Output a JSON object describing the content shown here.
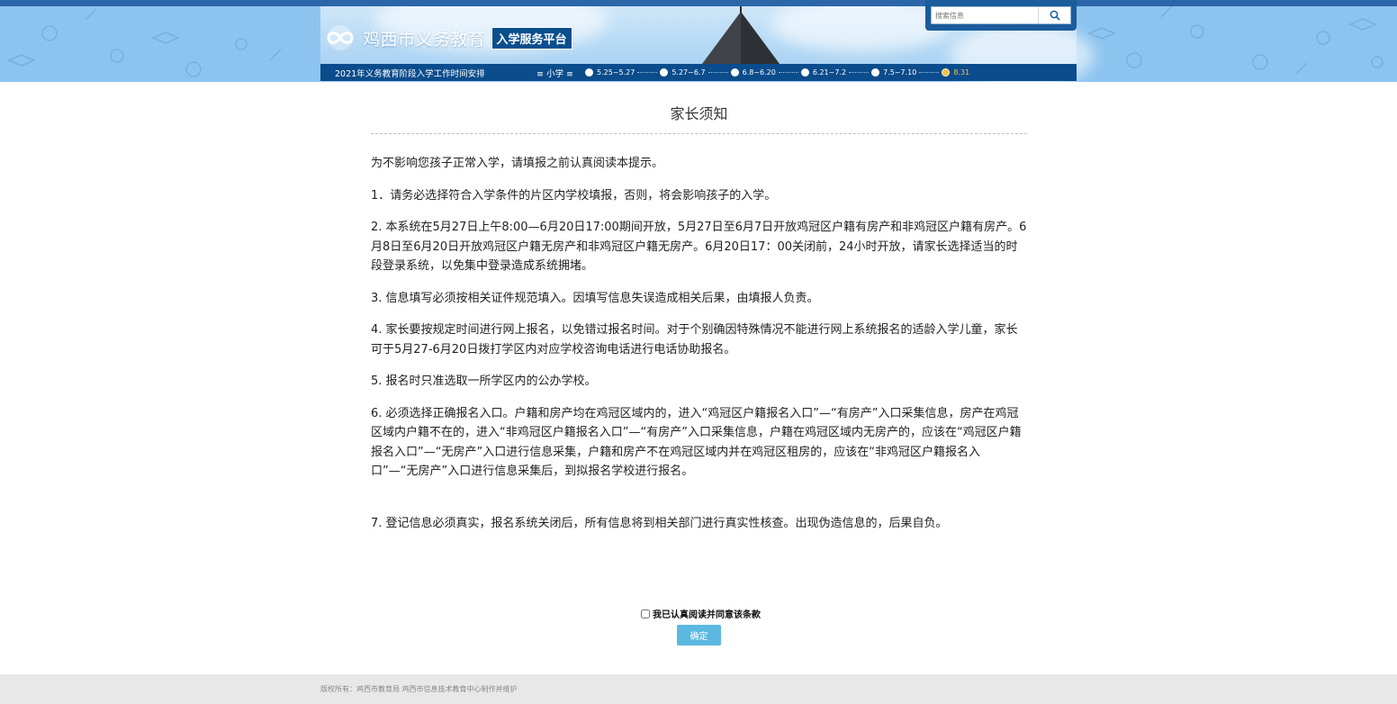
{
  "header": {
    "site_name": "鸡西市义务教育",
    "platform_badge": "入学服务平台",
    "logo_icon": "infinity-logo-icon"
  },
  "search": {
    "placeholder": "搜索信息",
    "icon": "search-icon"
  },
  "timeline": {
    "title": "2021年义务教育阶段入学工作时间安排",
    "school_level": "≡ 小学 ≡",
    "steps": [
      {
        "label": "5.25~5.27"
      },
      {
        "label": "5.27~6.7"
      },
      {
        "label": "6.8~6.20"
      },
      {
        "label": "6.21~7.2"
      },
      {
        "label": "7.5~7.10"
      },
      {
        "label": "8.31"
      }
    ]
  },
  "notice": {
    "title": "家长须知",
    "intro": "为不影响您孩子正常入学，请填报之前认真阅读本提示。",
    "items": [
      "1．请务必选择符合入学条件的片区内学校填报，否则，将会影响孩子的入学。",
      "2. 本系统在5月27日上午8:00—6月20日17:00期间开放，5月27日至6月7日开放鸡冠区户籍有房产和非鸡冠区户籍有房产。6月8日至6月20日开放鸡冠区户籍无房产和非鸡冠区户籍无房产。6月20日17：00关闭前，24小时开放，请家长选择适当的时段登录系统，以免集中登录造成系统拥堵。",
      "3. 信息填写必须按相关证件规范填入。因填写信息失误造成相关后果，由填报人负责。",
      "4. 家长要按规定时间进行网上报名，以免错过报名时间。对于个别确因特殊情况不能进行网上系统报名的适龄入学儿童，家长可于5月27-6月20日拨打学区内对应学校咨询电话进行电话协助报名。",
      "5. 报名时只准选取一所学区内的公办学校。",
      "6. 必须选择正确报名入口。户籍和房产均在鸡冠区域内的，进入“鸡冠区户籍报名入口”—“有房产”入口采集信息，房产在鸡冠区域内户籍不在的，进入“非鸡冠区户籍报名入口”—“有房产”入口采集信息，户籍在鸡冠区域内无房产的，应该在“鸡冠区户籍报名入口”—“无房产”入口进行信息采集，户籍和房产不在鸡冠区域内并在鸡冠区租房的，应该在“非鸡冠区户籍报名入口”—“无房产”入口进行信息采集后，到拟报名学校进行报名。",
      "7.  登记信息必须真实，报名系统关闭后，所有信息将到相关部门进行真实性核查。出现伪造信息的，后果自负。"
    ]
  },
  "agreement": {
    "label": "我已认真阅读并同意该条款",
    "checked": false
  },
  "confirm_button": "确定",
  "footer": {
    "copyright": "版权所有：鸡西市教育局 鸡西市信息技术教育中心制作并维护"
  },
  "colors": {
    "header_bg": "#8cc4ef",
    "nav_dark": "#0b4c8c",
    "button": "#5cb8e0",
    "active_step": "#f2c14e"
  }
}
